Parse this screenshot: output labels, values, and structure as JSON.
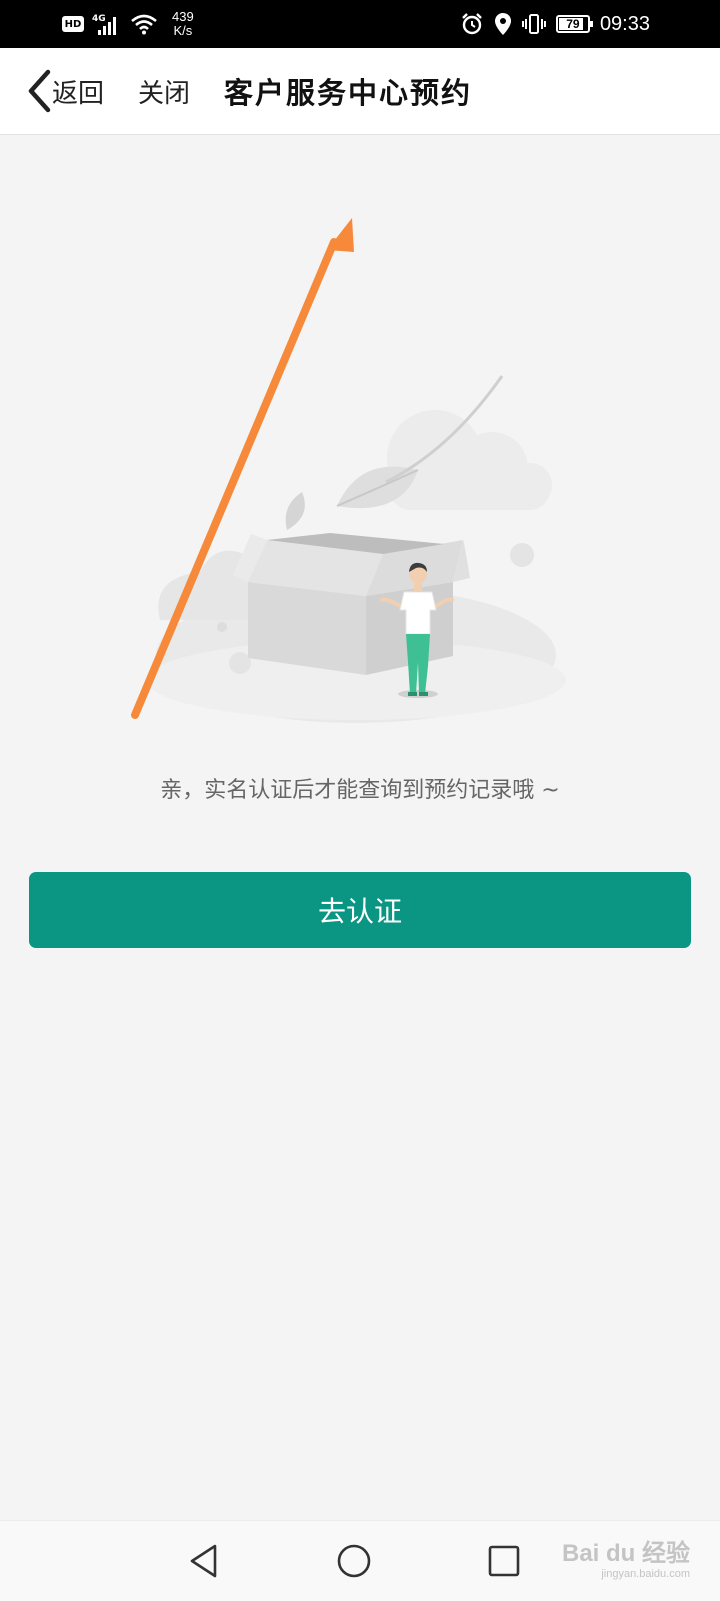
{
  "status_bar": {
    "hd_label": "HD",
    "network_type": "4G",
    "net_speed_value": "439",
    "net_speed_unit": "K/s",
    "battery_level": "79",
    "time": "09:33"
  },
  "header": {
    "back_label": "返回",
    "close_label": "关闭",
    "title": "客户服务中心预约"
  },
  "main": {
    "message": "亲，实名认证后才能查询到预约记录哦 ~",
    "verify_button": "去认证"
  },
  "illustration": {
    "description_icon": "empty-box-person-icon",
    "arrow_color": "#f6893a",
    "accent_color": "#0a9683"
  },
  "watermark": {
    "brand": "Bai du 经验",
    "url": "jingyan.baidu.com"
  }
}
